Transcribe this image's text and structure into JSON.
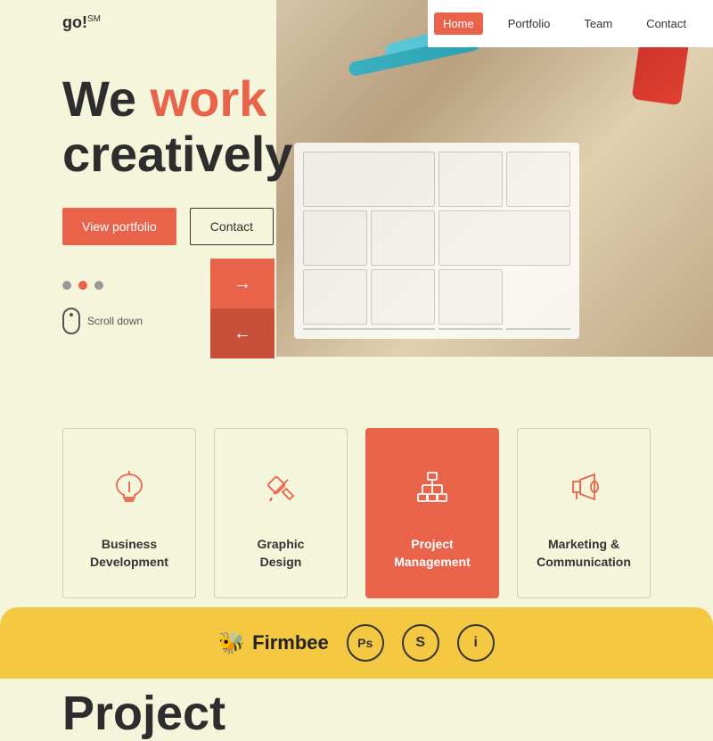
{
  "logo": {
    "text": "go!",
    "superscript": "SM"
  },
  "nav": {
    "links": [
      {
        "label": "Home",
        "active": true
      },
      {
        "label": "Portfolio",
        "active": false
      },
      {
        "label": "Team",
        "active": false
      },
      {
        "label": "Contact",
        "active": false
      }
    ]
  },
  "hero": {
    "title_line1": "We",
    "title_highlight": "work",
    "title_line2": "creatively",
    "btn_portfolio": "View portfolio",
    "btn_contact": "Contact",
    "scroll_label": "Scroll down",
    "arrow_next": "→",
    "arrow_prev": "←"
  },
  "dots": [
    {
      "active": false
    },
    {
      "active": true
    },
    {
      "active": false
    }
  ],
  "services": {
    "items": [
      {
        "label": "Business\nDevelopment",
        "icon": "bulb",
        "active": false
      },
      {
        "label": "Graphic\nDesign",
        "icon": "pencil-ruler",
        "active": false
      },
      {
        "label": "Project\nManagement",
        "icon": "hierarchy",
        "active": true
      },
      {
        "label": "Marketing &\nCommunication",
        "icon": "megaphone",
        "active": false
      }
    ]
  },
  "project_section": {
    "title": "Project"
  },
  "footer": {
    "brand_name": "Firmbee",
    "icons": [
      "Ps",
      "S",
      "i"
    ]
  }
}
